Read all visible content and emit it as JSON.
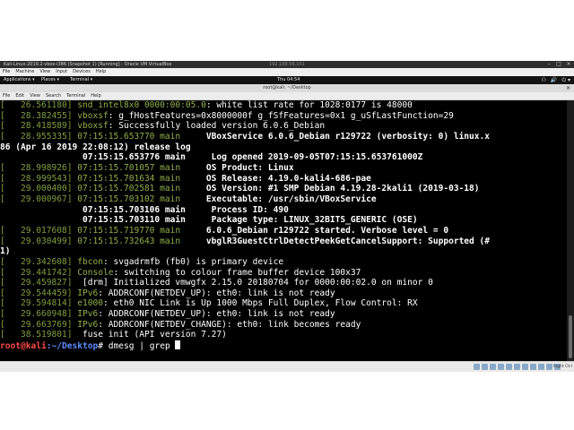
{
  "vbox": {
    "title": "Kali-Linux-2019.2-vbox-i386 (Snapshot 1) [Running] - Oracle VM VirtualBox",
    "center_text": "192.168.56.101",
    "menu": [
      "File",
      "Machine",
      "View",
      "Input",
      "Devices",
      "Help"
    ],
    "host_key": "Right Ctrl",
    "buttons": [
      "minimize-icon",
      "maximize-icon",
      "close-icon"
    ]
  },
  "gnome": {
    "applications": "Applications ▾",
    "places": "Places ▾",
    "terminal": "Terminal ▾",
    "clock": "Thu 04:54",
    "system_icons": [
      "⚇",
      "🔊",
      "⏻ ▾"
    ]
  },
  "terminal": {
    "title": "root@kali: ~/Desktop",
    "menu": [
      "File",
      "Edit",
      "View",
      "Search",
      "Terminal",
      "Help"
    ],
    "lines": [
      {
        "ts": "[   26.561180]",
        "sub": "snd_intel8x0 0000:00:05.0",
        "msg": ": white list rate for 1028:0177 is 48000"
      },
      {
        "ts": "[   28.382455]",
        "sub": "vboxsf",
        "msg": ": g_fHostFeatures=0x8000000f g_fSfFeatures=0x1 g_uSfLastFunction=29"
      },
      {
        "ts": "[   28.418589]",
        "sub": "vboxsf",
        "msg": ": Successfully loaded version 6.0.6_Debian"
      },
      {
        "ts": "[   28.955335]",
        "sub": "07:15:15.653770 main",
        "msg": "     VBoxService 6.0.6_Debian r129722 (verbosity: 0) linux.x"
      },
      {
        "ts": "",
        "sub": "",
        "msg": "86 (Apr 16 2019 22:08:12) release log"
      },
      {
        "ts": "",
        "sub": "",
        "msg": "                07:15:15.653776 main     Log opened 2019-09-05T07:15:15.653761000Z"
      },
      {
        "ts": "[   28.998926]",
        "sub": "07:15:15.701057 main",
        "msg": "     OS Product: Linux"
      },
      {
        "ts": "[   28.999543]",
        "sub": "07:15:15.701634 main",
        "msg": "     OS Release: 4.19.0-kali4-686-pae"
      },
      {
        "ts": "[   29.000400]",
        "sub": "07:15:15.702581 main",
        "msg": "     OS Version: #1 SMP Debian 4.19.28-2kali1 (2019-03-18)"
      },
      {
        "ts": "[   29.000967]",
        "sub": "07:15:15.703102 main",
        "msg": "     Executable: /usr/sbin/VBoxService"
      },
      {
        "ts": "",
        "sub": "",
        "msg": "                07:15:15.703106 main     Process ID: 490"
      },
      {
        "ts": "",
        "sub": "",
        "msg": "                07:15:15.703110 main     Package type: LINUX_32BITS_GENERIC (OSE)"
      },
      {
        "ts": "[   29.017608]",
        "sub": "07:15:15.719770 main",
        "msg": "     6.0.6_Debian r129722 started. Verbose level = 0"
      },
      {
        "ts": "[   29.030499]",
        "sub": "07:15:15.732643 main",
        "msg": "     vbglR3GuestCtrlDetectPeekGetCancelSupport: Supported (#"
      },
      {
        "ts": "",
        "sub": "",
        "msg": "1)"
      },
      {
        "ts": "[   29.342608]",
        "sub": "fbcon",
        "msg": ": svgadrmfb (fb0) is primary device"
      },
      {
        "ts": "[   29.441742]",
        "sub": "Console",
        "msg": ": switching to colour frame buffer device 100x37"
      },
      {
        "ts": "[   29.459827]",
        "sub": "",
        "msg": " [drm] Initialized vmwgfx 2.15.0 20180704 for 0000:00:02.0 on minor 0"
      },
      {
        "ts": "[   29.544459]",
        "sub": "IPv6",
        "msg": ": ADDRCONF(NETDEV_UP): eth0: link is not ready"
      },
      {
        "ts": "[   29.594814]",
        "sub": "e1000",
        "msg": ": eth0 NIC Link is Up 1000 Mbps Full Duplex, Flow Control: RX"
      },
      {
        "ts": "[   29.660948]",
        "sub": "IPv6",
        "msg": ": ADDRCONF(NETDEV_UP): eth0: link is not ready"
      },
      {
        "ts": "[   29.663769]",
        "sub": "IPv6",
        "msg": ": ADDRCONF(NETDEV_CHANGE): eth0: link becomes ready"
      },
      {
        "ts": "[   38.519801]",
        "sub": "",
        "msg": " fuse init (API version 7.27)"
      }
    ],
    "prompt_user": "root@kali",
    "prompt_path": ":~/Desktop",
    "command": "# dmesg | grep "
  }
}
